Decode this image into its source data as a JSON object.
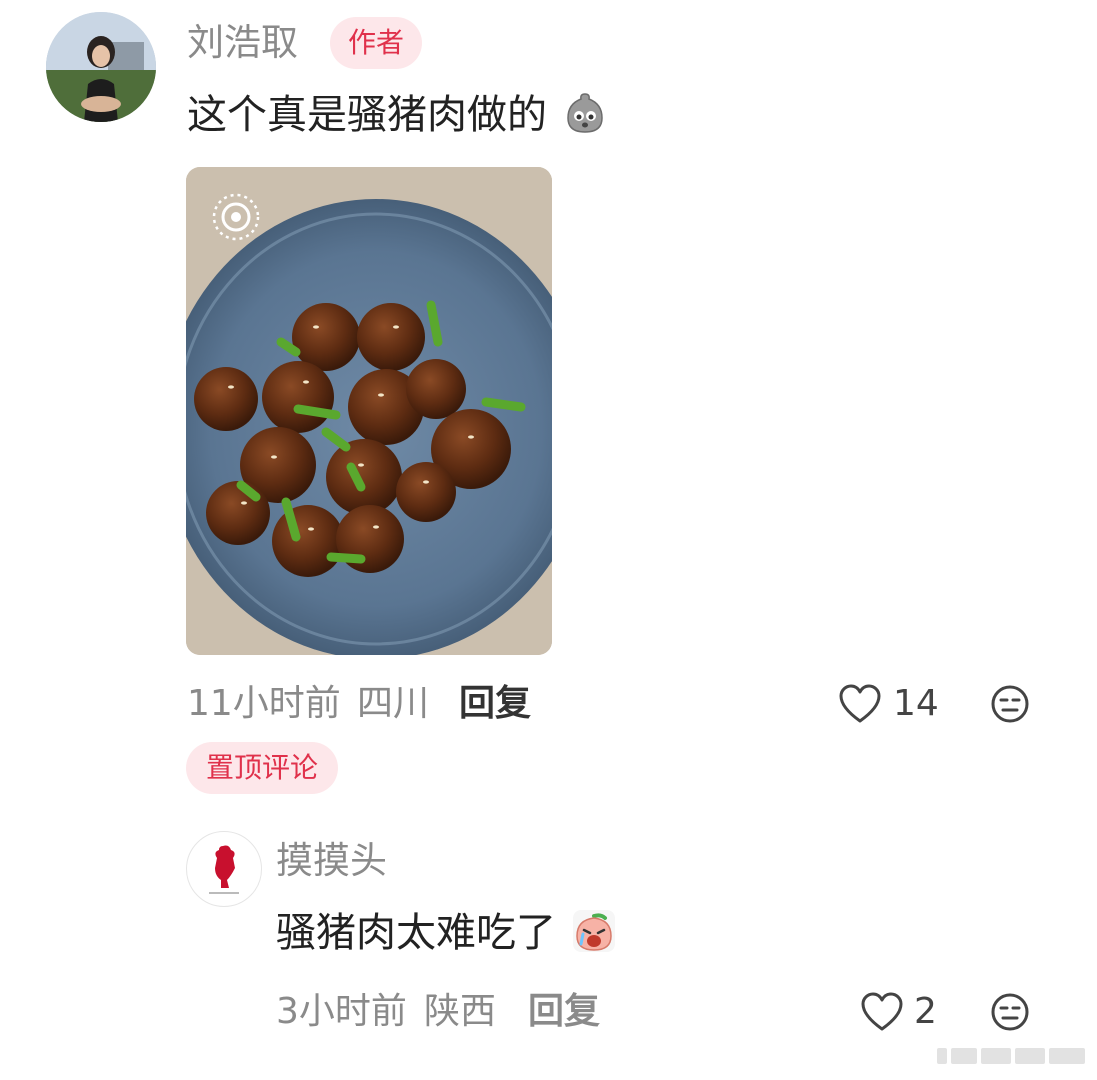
{
  "main_comment": {
    "author_name": "刘浩取",
    "author_badge": "作者",
    "text": "这个真是骚猪肉做的",
    "emoji": "sack-face-emoji",
    "time": "11小时前",
    "location": "四川",
    "reply_label": "回复",
    "like_count": "14",
    "pinned_label": "置顶评论"
  },
  "reply_comment": {
    "author_name": "摸摸头",
    "text": "骚猪肉太难吃了",
    "emoji": "crying-peach-emoji",
    "time": "3小时前",
    "location": "陕西",
    "reply_label": "回复",
    "like_count": "2"
  },
  "icons": {
    "like": "heart-outline-icon",
    "dislike": "meh-face-icon"
  },
  "colors": {
    "badge_bg": "#fde7ea",
    "badge_text": "#e0314b",
    "meta_text": "#8a8a8a"
  }
}
